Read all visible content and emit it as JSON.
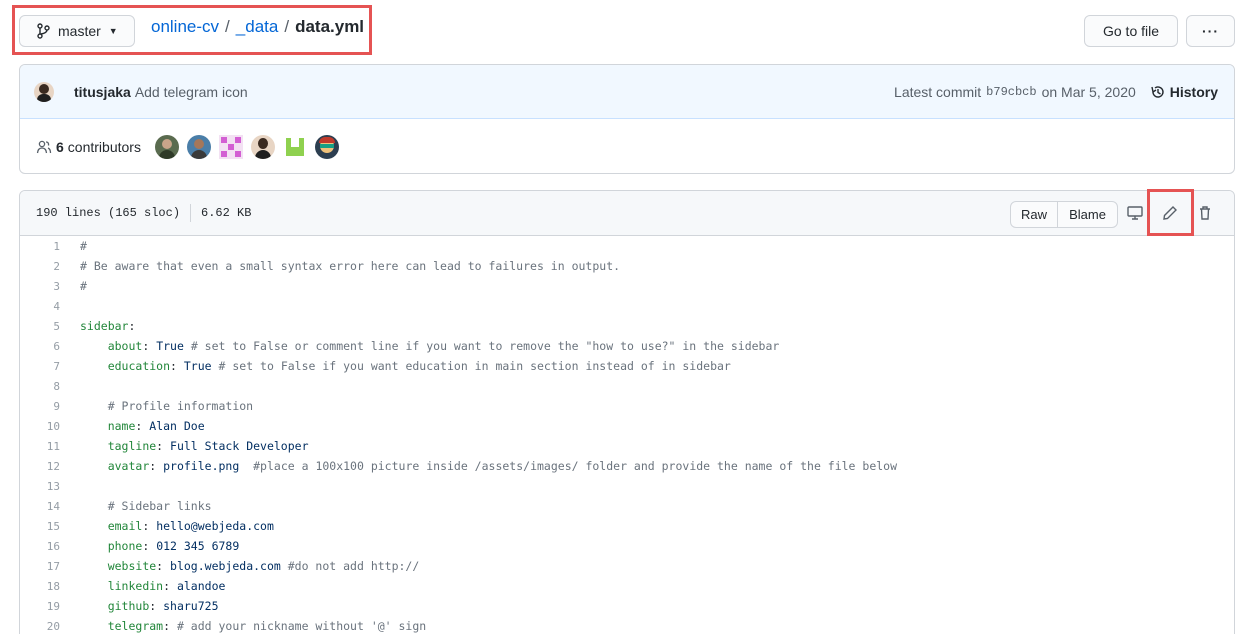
{
  "branch": {
    "label": "master"
  },
  "breadcrumb": {
    "repo": "online-cv",
    "folder": "_data",
    "file": "data.yml",
    "separator": "/"
  },
  "actions": {
    "goto_file": "Go to file",
    "more": "···"
  },
  "commit": {
    "author": "titusjaka",
    "message": "Add telegram icon",
    "latest_label": "Latest commit",
    "sha": "b79cbcb",
    "date": "on Mar 5, 2020",
    "history": "History"
  },
  "contributors": {
    "count": "6",
    "label": "contributors"
  },
  "file_info": {
    "lines": "190 lines (165 sloc)",
    "size": "6.62 KB",
    "raw": "Raw",
    "blame": "Blame"
  },
  "code_lines": [
    {
      "n": "1",
      "segs": [
        {
          "t": "#",
          "c": "c"
        }
      ]
    },
    {
      "n": "2",
      "segs": [
        {
          "t": "# Be aware that even a small syntax error here can lead to failures in output.",
          "c": "c"
        }
      ]
    },
    {
      "n": "3",
      "segs": [
        {
          "t": "#",
          "c": "c"
        }
      ]
    },
    {
      "n": "4",
      "segs": []
    },
    {
      "n": "5",
      "segs": [
        {
          "t": "sidebar",
          "c": "k"
        },
        {
          "t": ":",
          "c": ""
        }
      ]
    },
    {
      "n": "6",
      "segs": [
        {
          "t": "    ",
          "c": ""
        },
        {
          "t": "about",
          "c": "k"
        },
        {
          "t": ": ",
          "c": ""
        },
        {
          "t": "True",
          "c": "v"
        },
        {
          "t": " # set to False or comment line if you want to remove the \"how to use?\" in the sidebar",
          "c": "c"
        }
      ]
    },
    {
      "n": "7",
      "segs": [
        {
          "t": "    ",
          "c": ""
        },
        {
          "t": "education",
          "c": "k"
        },
        {
          "t": ": ",
          "c": ""
        },
        {
          "t": "True",
          "c": "v"
        },
        {
          "t": " # set to False if you want education in main section instead of in sidebar",
          "c": "c"
        }
      ]
    },
    {
      "n": "8",
      "segs": []
    },
    {
      "n": "9",
      "segs": [
        {
          "t": "    ",
          "c": ""
        },
        {
          "t": "# Profile information",
          "c": "c"
        }
      ]
    },
    {
      "n": "10",
      "segs": [
        {
          "t": "    ",
          "c": ""
        },
        {
          "t": "name",
          "c": "k"
        },
        {
          "t": ": ",
          "c": ""
        },
        {
          "t": "Alan Doe",
          "c": "v"
        }
      ]
    },
    {
      "n": "11",
      "segs": [
        {
          "t": "    ",
          "c": ""
        },
        {
          "t": "tagline",
          "c": "k"
        },
        {
          "t": ": ",
          "c": ""
        },
        {
          "t": "Full Stack Developer",
          "c": "v"
        }
      ]
    },
    {
      "n": "12",
      "segs": [
        {
          "t": "    ",
          "c": ""
        },
        {
          "t": "avatar",
          "c": "k"
        },
        {
          "t": ": ",
          "c": ""
        },
        {
          "t": "profile.png",
          "c": "v"
        },
        {
          "t": "  #place a 100x100 picture inside /assets/images/ folder and provide the name of the file below",
          "c": "c"
        }
      ]
    },
    {
      "n": "13",
      "segs": []
    },
    {
      "n": "14",
      "segs": [
        {
          "t": "    ",
          "c": ""
        },
        {
          "t": "# Sidebar links",
          "c": "c"
        }
      ]
    },
    {
      "n": "15",
      "segs": [
        {
          "t": "    ",
          "c": ""
        },
        {
          "t": "email",
          "c": "k"
        },
        {
          "t": ": ",
          "c": ""
        },
        {
          "t": "hello@webjeda.com",
          "c": "v"
        }
      ]
    },
    {
      "n": "16",
      "segs": [
        {
          "t": "    ",
          "c": ""
        },
        {
          "t": "phone",
          "c": "k"
        },
        {
          "t": ": ",
          "c": ""
        },
        {
          "t": "012 345 6789",
          "c": "v"
        }
      ]
    },
    {
      "n": "17",
      "segs": [
        {
          "t": "    ",
          "c": ""
        },
        {
          "t": "website",
          "c": "k"
        },
        {
          "t": ": ",
          "c": ""
        },
        {
          "t": "blog.webjeda.com",
          "c": "v"
        },
        {
          "t": " #do not add http://",
          "c": "c"
        }
      ]
    },
    {
      "n": "18",
      "segs": [
        {
          "t": "    ",
          "c": ""
        },
        {
          "t": "linkedin",
          "c": "k"
        },
        {
          "t": ": ",
          "c": ""
        },
        {
          "t": "alandoe",
          "c": "v"
        }
      ]
    },
    {
      "n": "19",
      "segs": [
        {
          "t": "    ",
          "c": ""
        },
        {
          "t": "github",
          "c": "k"
        },
        {
          "t": ": ",
          "c": ""
        },
        {
          "t": "sharu725",
          "c": "v"
        }
      ]
    },
    {
      "n": "20",
      "segs": [
        {
          "t": "    ",
          "c": ""
        },
        {
          "t": "telegram",
          "c": "k"
        },
        {
          "t": ": ",
          "c": ""
        },
        {
          "t": "# add your nickname without '@' sign",
          "c": "c"
        }
      ]
    }
  ],
  "colors": {
    "highlight": "#e55353",
    "link": "#0366d6",
    "commit_bg": "#f1f8ff"
  }
}
